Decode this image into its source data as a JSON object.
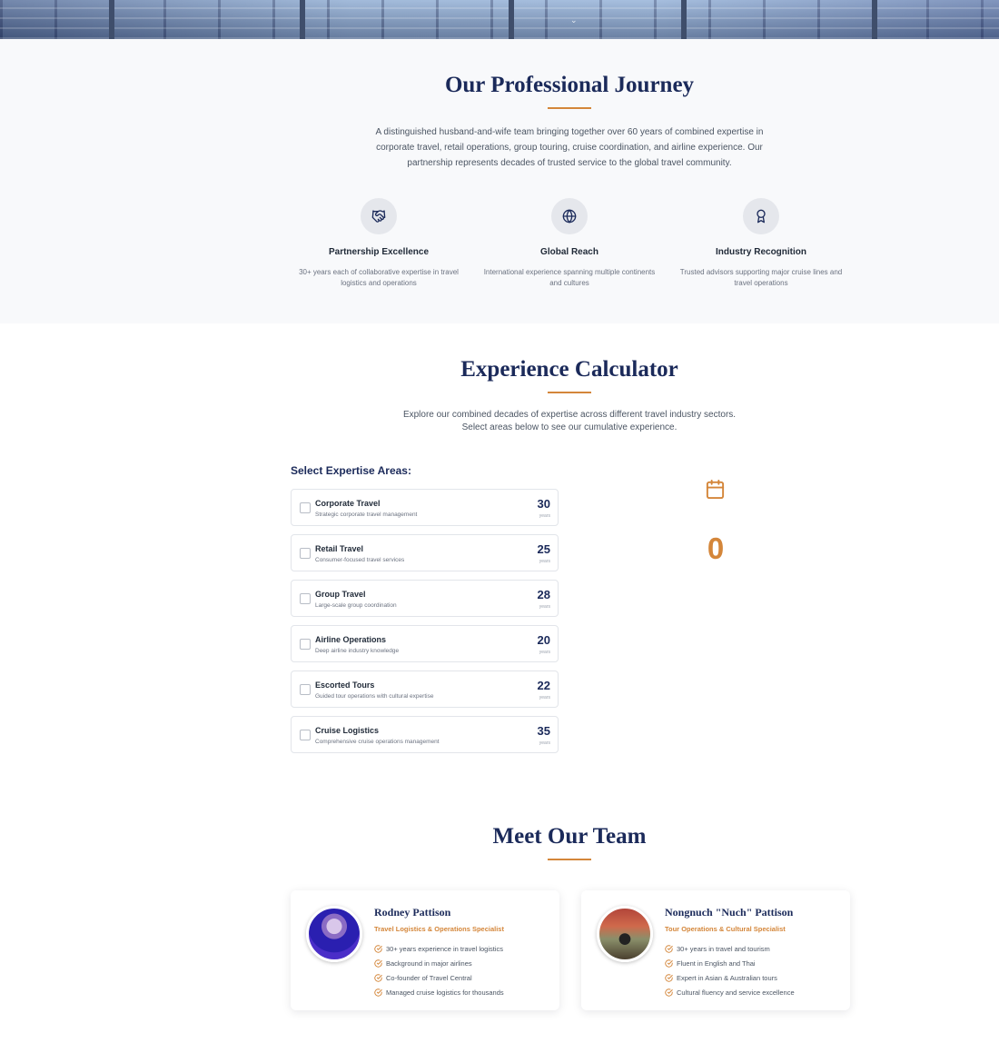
{
  "hero": {
    "scroll_icon": "chevron-down-icon",
    "scroll_glyph": "⌄"
  },
  "journey": {
    "title": "Our Professional Journey",
    "intro_lines": [
      "A distinguished husband-and-wife team bringing together over 60 years of combined expertise in",
      "corporate travel, retail operations, group touring, cruise coordination, and airline experience. Our",
      "partnership represents decades of trusted service to the global travel community."
    ],
    "features": [
      {
        "icon": "handshake-icon",
        "title": "Partnership Excellence",
        "desc_lines": [
          "30+ years each of collaborative expertise in travel",
          "logistics and operations"
        ]
      },
      {
        "icon": "globe-icon",
        "title": "Global Reach",
        "desc_lines": [
          "International experience spanning multiple continents",
          "and cultures"
        ]
      },
      {
        "icon": "award-icon",
        "title": "Industry Recognition",
        "desc_lines": [
          "Trusted advisors supporting major cruise lines and",
          "travel operations"
        ]
      }
    ]
  },
  "calculator": {
    "title": "Experience Calculator",
    "intro_lines": [
      "Explore our combined decades of expertise across different travel industry sectors.",
      "Select areas below to see our cumulative experience."
    ],
    "select_label": "Select Expertise Areas:",
    "unit_label": "years",
    "areas": [
      {
        "name": "Corporate Travel",
        "desc": "Strategic corporate travel management",
        "years": "30",
        "checked": false
      },
      {
        "name": "Retail Travel",
        "desc": "Consumer-focused travel services",
        "years": "25",
        "checked": false
      },
      {
        "name": "Group Travel",
        "desc": "Large-scale group coordination",
        "years": "28",
        "checked": false
      },
      {
        "name": "Airline Operations",
        "desc": "Deep airline industry knowledge",
        "years": "20",
        "checked": false
      },
      {
        "name": "Escorted Tours",
        "desc": "Guided tour operations with cultural expertise",
        "years": "22",
        "checked": false
      },
      {
        "name": "Cruise Logistics",
        "desc": "Comprehensive cruise operations management",
        "years": "35",
        "checked": false
      }
    ],
    "total_icon": "calendar-icon",
    "total_value": "0"
  },
  "team": {
    "title": "Meet Our Team",
    "members": [
      {
        "name": "Rodney Pattison",
        "role": "Travel Logistics & Operations Specialist",
        "highlights": [
          "30+ years experience in travel logistics",
          "Background in major airlines",
          "Co-founder of Travel Central",
          "Managed cruise logistics for thousands"
        ]
      },
      {
        "name": "Nongnuch \"Nuch\" Pattison",
        "role": "Tour Operations & Cultural Specialist",
        "highlights": [
          "30+ years in travel and tourism",
          "Fluent in English and Thai",
          "Expert in Asian & Australian tours",
          "Cultural fluency and service excellence"
        ]
      }
    ]
  },
  "colors": {
    "navy": "#1b2a5a",
    "accent": "#d4863a",
    "section_bg": "#f8f9fb"
  }
}
